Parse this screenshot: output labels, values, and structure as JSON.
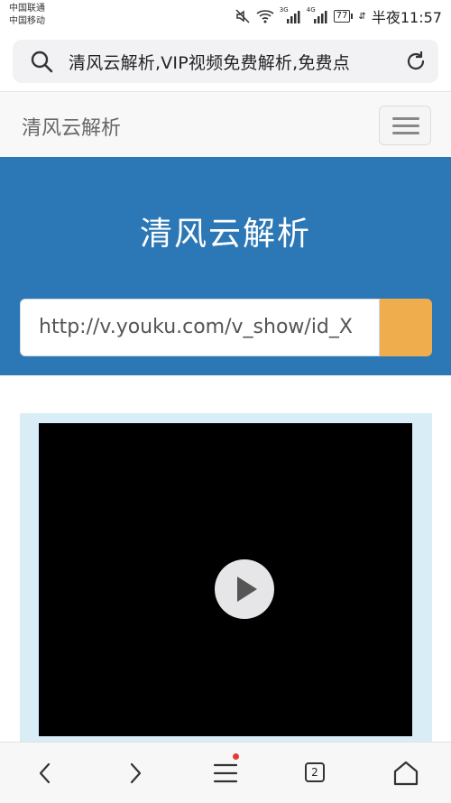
{
  "status_bar": {
    "carrier_1": "中国联通",
    "carrier_2": "中国移动",
    "net_1": "3G",
    "net_2": "4G",
    "battery": "77",
    "time": "半夜11:57"
  },
  "browser": {
    "address_text": "清风云解析,VIP视频免费解析,免费点",
    "tab_count": "2"
  },
  "site": {
    "brand": "清风云解析",
    "hero_title": "清风云解析",
    "url_value": "http://v.youku.com/v_show/id_X",
    "url_button_glyph": ""
  },
  "colors": {
    "hero_bg": "#2c77b5",
    "button_bg": "#f0ad4e",
    "player_frame_bg": "#d9edf7"
  }
}
